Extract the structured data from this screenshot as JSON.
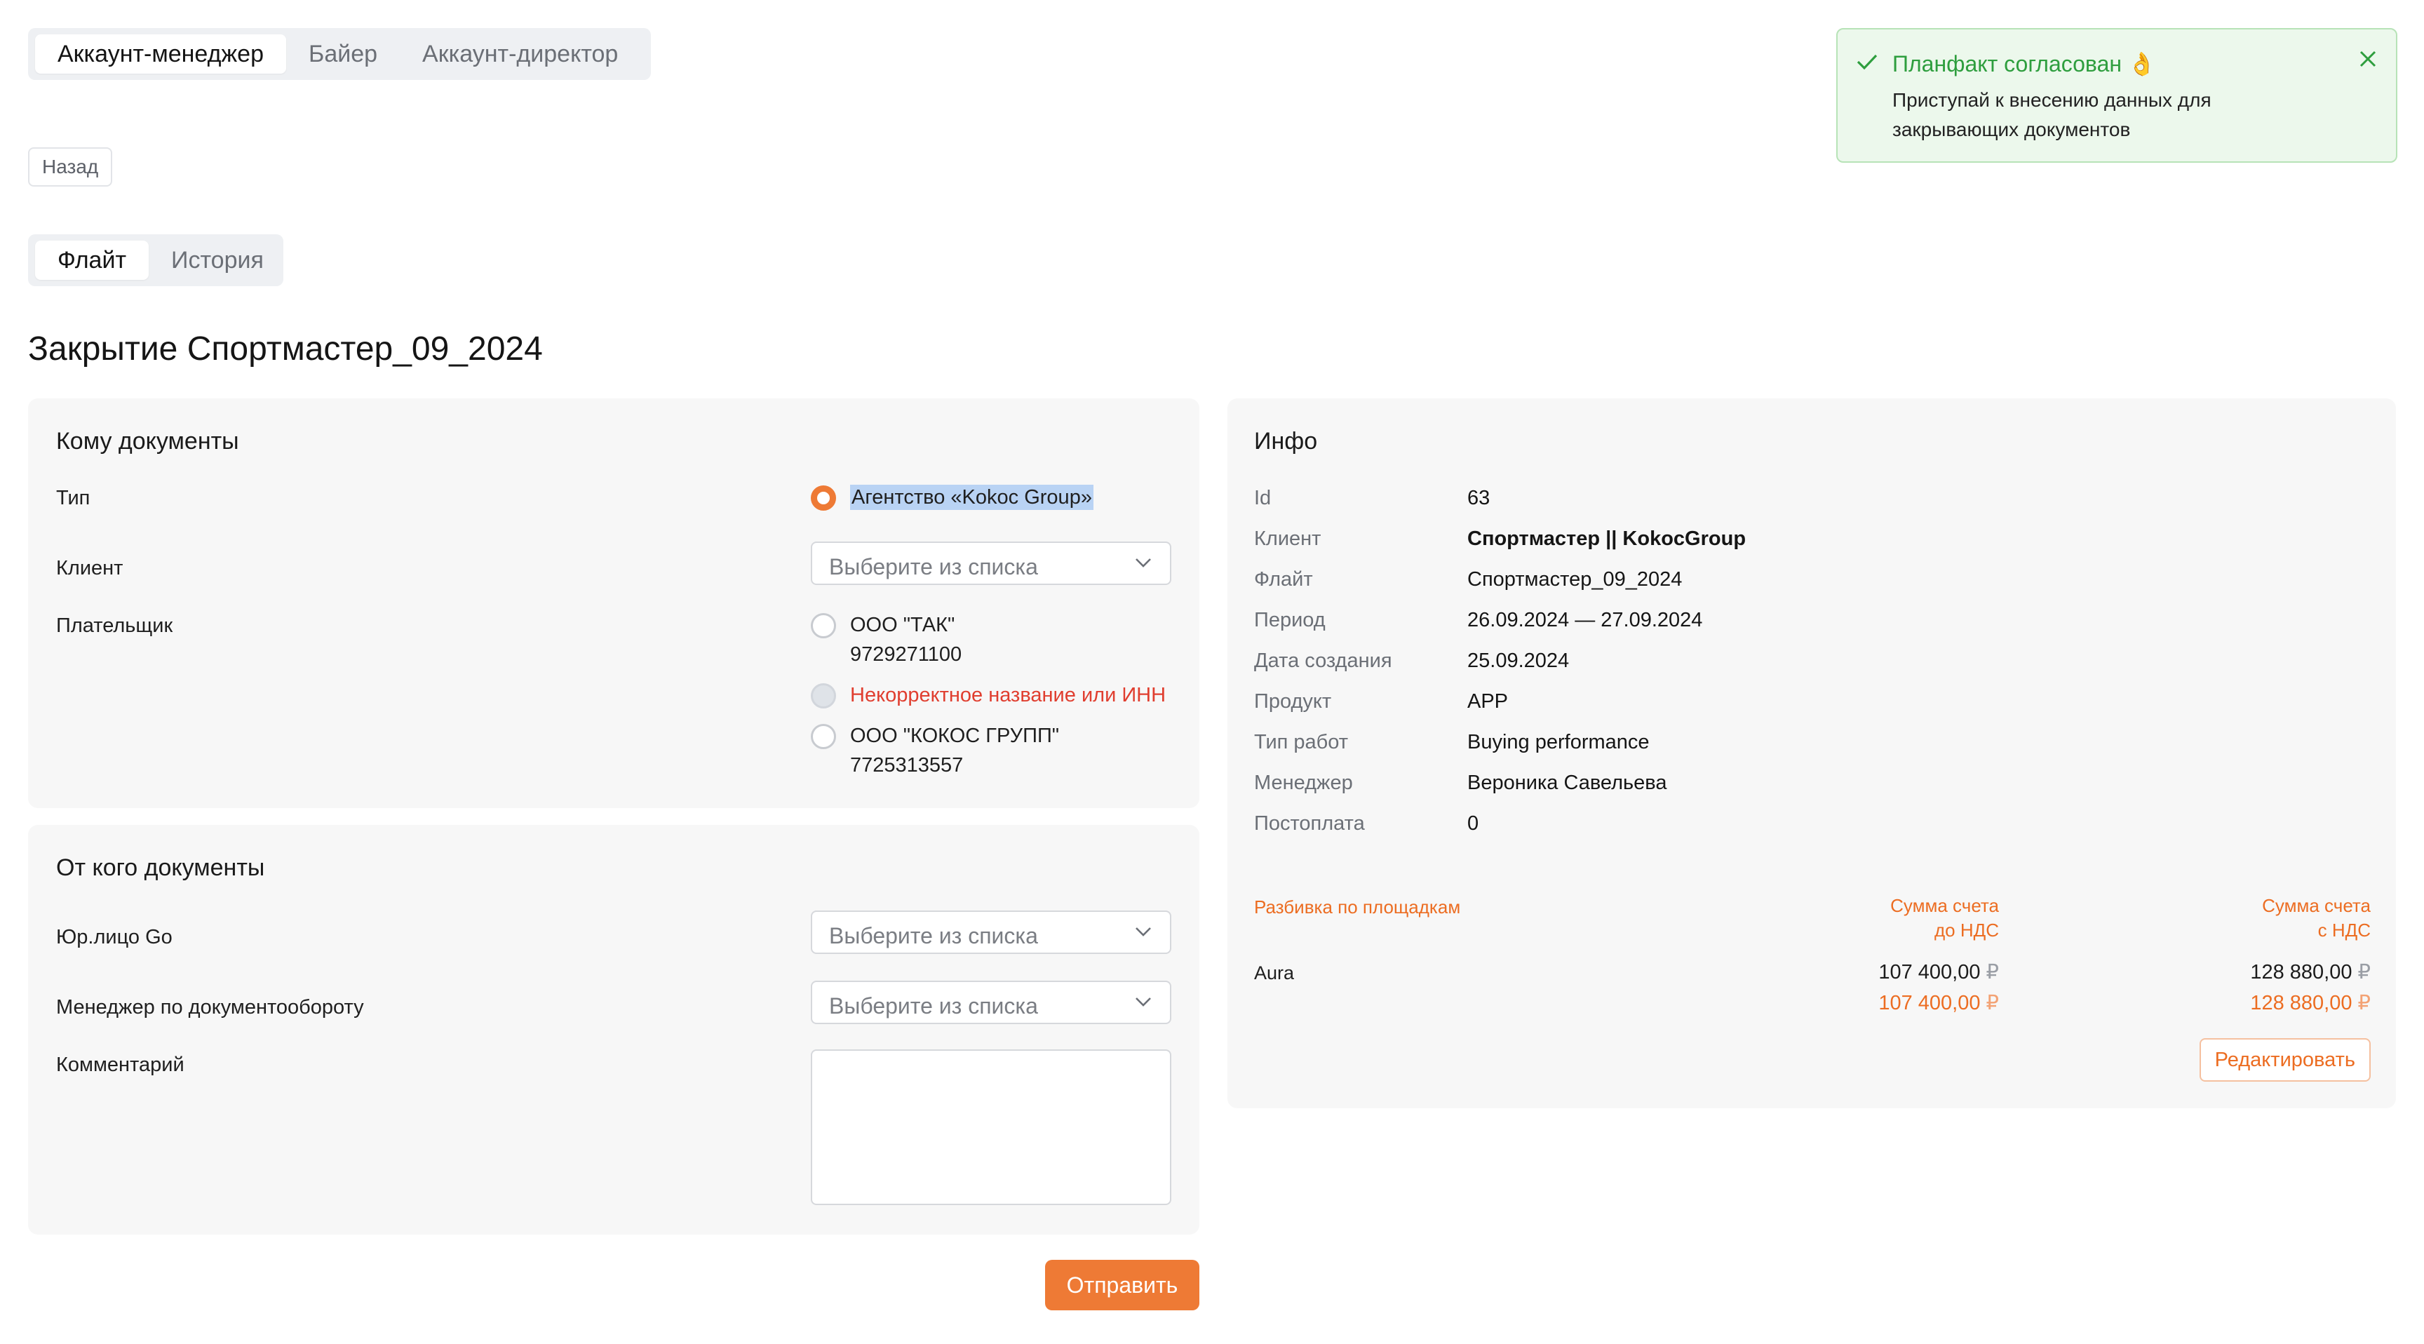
{
  "role_tabs": [
    "Аккаунт-менеджер",
    "Байер",
    "Аккаунт-директор"
  ],
  "back_label": "Назад",
  "view_tabs": [
    "Флайт",
    "История"
  ],
  "page_title": "Закрытие Спортмастер_09_2024",
  "to_docs": {
    "title": "Кому документы",
    "type_label": "Тип",
    "type_value": "Агентство «Kokoc Group»",
    "client_label": "Клиент",
    "client_placeholder": "Выберите из списка",
    "payer_label": "Плательщик",
    "payers": [
      {
        "name": "ООО \"ТАК\"",
        "inn": "9729271100"
      },
      {
        "name": "Некорректное название или ИНН",
        "inn": ""
      },
      {
        "name": "ООО \"КОКОС ГРУПП\"",
        "inn": "7725313557"
      }
    ]
  },
  "from_docs": {
    "title": "От кого документы",
    "legal_label": "Юр.лицо Go",
    "legal_placeholder": "Выберите из списка",
    "docflow_label": "Менеджер по документообороту",
    "docflow_placeholder": "Выберите из списка",
    "comment_label": "Комментарий",
    "comment_value": ""
  },
  "submit_label": "Отправить",
  "info": {
    "title": "Инфо",
    "rows": [
      {
        "k": "Id",
        "v": "63"
      },
      {
        "k": "Клиент",
        "v": "Спортмастер || KokocGroup"
      },
      {
        "k": "Флайт",
        "v": "Спортмастер_09_2024"
      },
      {
        "k": "Период",
        "v": "26.09.2024 — 27.09.2024"
      },
      {
        "k": "Дата создания",
        "v": "25.09.2024"
      },
      {
        "k": "Продукт",
        "v": "APP"
      },
      {
        "k": "Тип работ",
        "v": "Buying performance"
      },
      {
        "k": "Менеджер",
        "v": "Вероника Савельева"
      },
      {
        "k": "Постоплата",
        "v": "0"
      }
    ],
    "breakdown": {
      "header": "Разбивка по площадкам",
      "col1_line1": "Сумма счета",
      "col1_line2": "до НДС",
      "col2_line1": "Сумма счета",
      "col2_line2": "с НДС",
      "platform": "Aura",
      "ex_vat": "107 400,00",
      "inc_vat": "128 880,00",
      "total_ex_vat": "107 400,00",
      "total_inc_vat": "128 880,00",
      "currency": "₽"
    },
    "edit_label": "Редактировать"
  },
  "toast": {
    "title": "Планфакт согласован 👌",
    "message": "Приступай к внесению данных для закрывающих документов"
  },
  "colors": {
    "accent": "#ee7a35",
    "success": "#2e9e3e",
    "error": "#e03e2f",
    "card_bg": "#f7f7f7"
  }
}
